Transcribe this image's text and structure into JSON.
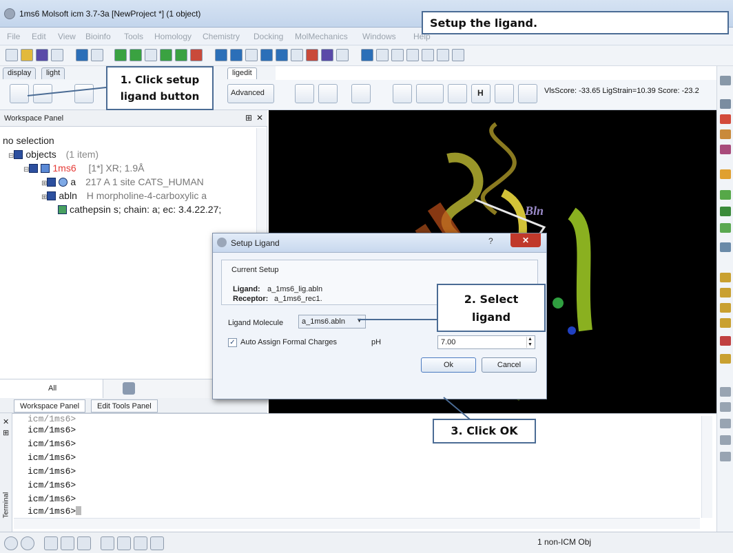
{
  "window": {
    "title": "1ms6 Molsoft icm 3.7-3a  [NewProject *] (1 object)"
  },
  "menu": [
    "File",
    "Edit",
    "View",
    "Bioinfo",
    "Tools",
    "Homology",
    "Chemistry",
    "Docking",
    "MolMechanics",
    "Windows",
    "Help"
  ],
  "tabs": [
    "display",
    "light",
    "ligedit"
  ],
  "toolbar2": {
    "advanced_label": "Advanced",
    "score_text": "VlsScore: -33.65 LigStrain=10.39 Score: -23.2"
  },
  "workspace": {
    "header": "Workspace Panel",
    "selection": "no selection",
    "objects_label": "objects",
    "objects_count": "(1 item)",
    "mol_name": "1ms6",
    "mol_info": "[1*] XR; 1.9Å",
    "row_a_name": "a",
    "row_a_info": "217 A 1 site CATS_HUMAN",
    "row_abln_name": "abln",
    "row_abln_info": "H  morpholine-4-carboxylic a",
    "row_desc": "cathepsin s; chain: a; ec: 3.4.22.27;",
    "all_tab": "All",
    "bottom_tabs": [
      "Workspace Panel",
      "Edit Tools Panel"
    ]
  },
  "viewport": {
    "label": "Bln"
  },
  "dialog": {
    "title": "Setup Ligand",
    "help": "?",
    "close": "✕",
    "group_title": "Current Setup",
    "ligand_key": "Ligand:",
    "ligand_val": "a_1ms6_lig.abln",
    "receptor_key": "Receptor:",
    "receptor_val": "a_1ms6_rec1.",
    "ligand_molecule_label": "Ligand Molecule",
    "ligand_molecule_value": "a_1ms6.abln",
    "auto_assign_label": "Auto Assign Formal Charges",
    "ph_label": "pH",
    "ph_value": "7.00",
    "ok_label": "Ok",
    "cancel_label": "Cancel"
  },
  "terminal": {
    "lines": [
      "icm/1ms6>",
      "icm/1ms6>",
      "icm/1ms6>",
      "icm/1ms6>",
      "icm/1ms6>",
      "icm/1ms6>",
      "icm/1ms6>",
      "icm/1ms6>"
    ],
    "side_label": "Terminal"
  },
  "status": {
    "text": "1 non-ICM Obj"
  },
  "callouts": {
    "header": "Setup the ligand.",
    "step1": "1. Click setup ligand button",
    "step2": "2. Select ligand",
    "step3": "3. Click OK"
  },
  "colors": {
    "accent": "#4a6b94",
    "mol_name": "#e53935",
    "viewport_bg": "#000000"
  }
}
